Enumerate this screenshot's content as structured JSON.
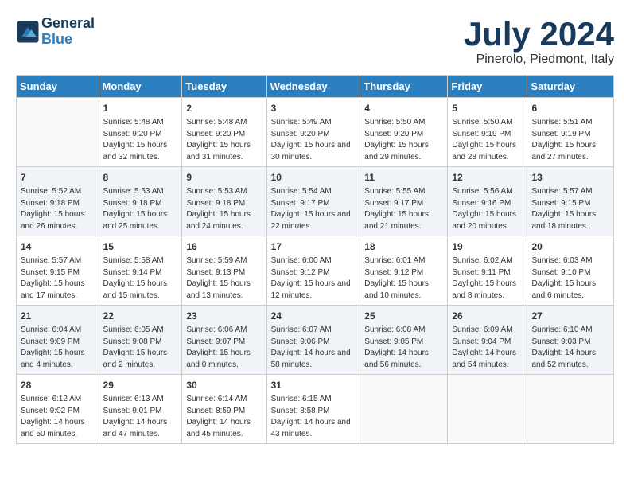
{
  "header": {
    "logo_line1": "General",
    "logo_line2": "Blue",
    "month": "July 2024",
    "location": "Pinerolo, Piedmont, Italy"
  },
  "weekdays": [
    "Sunday",
    "Monday",
    "Tuesday",
    "Wednesday",
    "Thursday",
    "Friday",
    "Saturday"
  ],
  "weeks": [
    [
      {
        "day": "",
        "sunrise": "",
        "sunset": "",
        "daylight": ""
      },
      {
        "day": "1",
        "sunrise": "5:48 AM",
        "sunset": "9:20 PM",
        "daylight": "15 hours and 32 minutes."
      },
      {
        "day": "2",
        "sunrise": "5:48 AM",
        "sunset": "9:20 PM",
        "daylight": "15 hours and 31 minutes."
      },
      {
        "day": "3",
        "sunrise": "5:49 AM",
        "sunset": "9:20 PM",
        "daylight": "15 hours and 30 minutes."
      },
      {
        "day": "4",
        "sunrise": "5:50 AM",
        "sunset": "9:20 PM",
        "daylight": "15 hours and 29 minutes."
      },
      {
        "day": "5",
        "sunrise": "5:50 AM",
        "sunset": "9:19 PM",
        "daylight": "15 hours and 28 minutes."
      },
      {
        "day": "6",
        "sunrise": "5:51 AM",
        "sunset": "9:19 PM",
        "daylight": "15 hours and 27 minutes."
      }
    ],
    [
      {
        "day": "7",
        "sunrise": "5:52 AM",
        "sunset": "9:18 PM",
        "daylight": "15 hours and 26 minutes."
      },
      {
        "day": "8",
        "sunrise": "5:53 AM",
        "sunset": "9:18 PM",
        "daylight": "15 hours and 25 minutes."
      },
      {
        "day": "9",
        "sunrise": "5:53 AM",
        "sunset": "9:18 PM",
        "daylight": "15 hours and 24 minutes."
      },
      {
        "day": "10",
        "sunrise": "5:54 AM",
        "sunset": "9:17 PM",
        "daylight": "15 hours and 22 minutes."
      },
      {
        "day": "11",
        "sunrise": "5:55 AM",
        "sunset": "9:17 PM",
        "daylight": "15 hours and 21 minutes."
      },
      {
        "day": "12",
        "sunrise": "5:56 AM",
        "sunset": "9:16 PM",
        "daylight": "15 hours and 20 minutes."
      },
      {
        "day": "13",
        "sunrise": "5:57 AM",
        "sunset": "9:15 PM",
        "daylight": "15 hours and 18 minutes."
      }
    ],
    [
      {
        "day": "14",
        "sunrise": "5:57 AM",
        "sunset": "9:15 PM",
        "daylight": "15 hours and 17 minutes."
      },
      {
        "day": "15",
        "sunrise": "5:58 AM",
        "sunset": "9:14 PM",
        "daylight": "15 hours and 15 minutes."
      },
      {
        "day": "16",
        "sunrise": "5:59 AM",
        "sunset": "9:13 PM",
        "daylight": "15 hours and 13 minutes."
      },
      {
        "day": "17",
        "sunrise": "6:00 AM",
        "sunset": "9:12 PM",
        "daylight": "15 hours and 12 minutes."
      },
      {
        "day": "18",
        "sunrise": "6:01 AM",
        "sunset": "9:12 PM",
        "daylight": "15 hours and 10 minutes."
      },
      {
        "day": "19",
        "sunrise": "6:02 AM",
        "sunset": "9:11 PM",
        "daylight": "15 hours and 8 minutes."
      },
      {
        "day": "20",
        "sunrise": "6:03 AM",
        "sunset": "9:10 PM",
        "daylight": "15 hours and 6 minutes."
      }
    ],
    [
      {
        "day": "21",
        "sunrise": "6:04 AM",
        "sunset": "9:09 PM",
        "daylight": "15 hours and 4 minutes."
      },
      {
        "day": "22",
        "sunrise": "6:05 AM",
        "sunset": "9:08 PM",
        "daylight": "15 hours and 2 minutes."
      },
      {
        "day": "23",
        "sunrise": "6:06 AM",
        "sunset": "9:07 PM",
        "daylight": "15 hours and 0 minutes."
      },
      {
        "day": "24",
        "sunrise": "6:07 AM",
        "sunset": "9:06 PM",
        "daylight": "14 hours and 58 minutes."
      },
      {
        "day": "25",
        "sunrise": "6:08 AM",
        "sunset": "9:05 PM",
        "daylight": "14 hours and 56 minutes."
      },
      {
        "day": "26",
        "sunrise": "6:09 AM",
        "sunset": "9:04 PM",
        "daylight": "14 hours and 54 minutes."
      },
      {
        "day": "27",
        "sunrise": "6:10 AM",
        "sunset": "9:03 PM",
        "daylight": "14 hours and 52 minutes."
      }
    ],
    [
      {
        "day": "28",
        "sunrise": "6:12 AM",
        "sunset": "9:02 PM",
        "daylight": "14 hours and 50 minutes."
      },
      {
        "day": "29",
        "sunrise": "6:13 AM",
        "sunset": "9:01 PM",
        "daylight": "14 hours and 47 minutes."
      },
      {
        "day": "30",
        "sunrise": "6:14 AM",
        "sunset": "8:59 PM",
        "daylight": "14 hours and 45 minutes."
      },
      {
        "day": "31",
        "sunrise": "6:15 AM",
        "sunset": "8:58 PM",
        "daylight": "14 hours and 43 minutes."
      },
      {
        "day": "",
        "sunrise": "",
        "sunset": "",
        "daylight": ""
      },
      {
        "day": "",
        "sunrise": "",
        "sunset": "",
        "daylight": ""
      },
      {
        "day": "",
        "sunrise": "",
        "sunset": "",
        "daylight": ""
      }
    ]
  ],
  "labels": {
    "sunrise": "Sunrise:",
    "sunset": "Sunset:",
    "daylight": "Daylight:"
  }
}
